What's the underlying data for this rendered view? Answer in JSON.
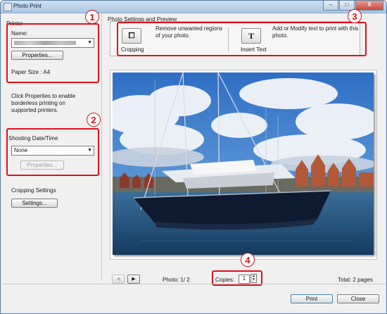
{
  "window": {
    "title": "Photo Print",
    "minimize": "–",
    "maximize": "□",
    "close": "X"
  },
  "printer": {
    "heading": "Printer",
    "name_label": "Name:",
    "properties_label": "Properties...",
    "paper_size": "Paper Size : A4"
  },
  "info_text": [
    "Click Properties to enable",
    "borderless printing on",
    "supported printers."
  ],
  "shooting": {
    "heading": "Shooting Date/Time",
    "selected": "None",
    "properties_label": "Properties..."
  },
  "cropping": {
    "heading": "Cropping Settings",
    "settings_label": "Settings..."
  },
  "photo_settings": {
    "heading": "Photo Settings and Preview",
    "cropping": {
      "glyph": "⧠",
      "label": "Cropping",
      "desc": [
        "Remove unwanted regions",
        "of your photo."
      ]
    },
    "insert_text": {
      "glyph": "T",
      "label": "Insert Text",
      "desc": [
        "Add or Modify text to print with this",
        "photo."
      ]
    }
  },
  "nav": {
    "prev": "◀",
    "next": "▶",
    "photo_counter": "Photo: 1/ 2"
  },
  "copies": {
    "label": "Copies:",
    "value": "1"
  },
  "total": "Total: 2 pages",
  "footer": {
    "print": "Print",
    "close": "Close"
  },
  "callouts": [
    "1",
    "2",
    "3",
    "4"
  ],
  "colors": {
    "callout": "#e0101c",
    "sky": "#3a78c8",
    "hull": "#0f1a2e",
    "water": "#1e4f7a"
  }
}
